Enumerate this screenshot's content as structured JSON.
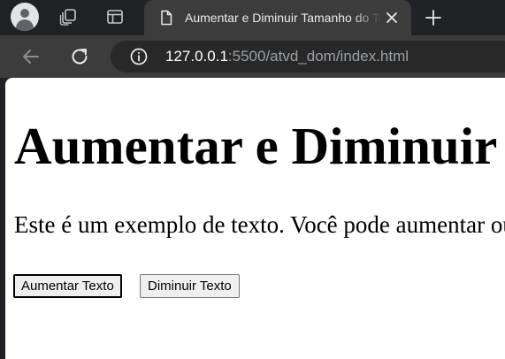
{
  "browser": {
    "tab": {
      "title": "Aumentar e Diminuir Tamanho do Texto"
    },
    "address_bar": {
      "url_host": "127.0.0.1",
      "url_rest": ":5500/atvd_dom/index.html"
    }
  },
  "page": {
    "heading": "Aumentar e Diminuir Tamanho do Texto",
    "paragraph": "Este é um exemplo de texto. Você pode aumentar ou diminuir o tamanho dele.",
    "buttons": {
      "increase_label": "Aumentar Texto",
      "decrease_label": "Diminuir Texto"
    }
  }
}
